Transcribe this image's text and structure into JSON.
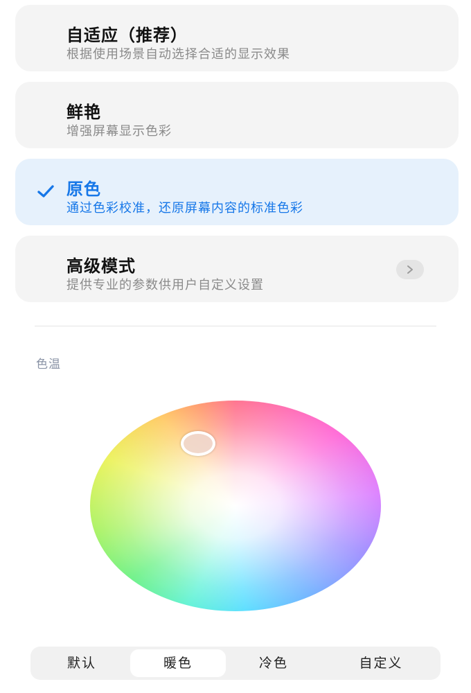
{
  "options": [
    {
      "title": "自适应（推荐）",
      "subtitle": "根据使用场景自动选择合适的显示效果",
      "selected": false
    },
    {
      "title": "鲜艳",
      "subtitle": "增强屏幕显示色彩",
      "selected": false
    },
    {
      "title": "原色",
      "subtitle": "通过色彩校准，还原屏幕内容的标准色彩",
      "selected": true
    },
    {
      "title": "高级模式",
      "subtitle": "提供专业的参数供用户自定义设置",
      "selected": false
    }
  ],
  "color_temperature": {
    "label": "色温",
    "presets": [
      "默认",
      "暖色",
      "冷色",
      "自定义"
    ],
    "active_preset": "暖色"
  },
  "colors": {
    "accent": "#1677e8",
    "selected_card_bg": "#e6f1fc",
    "card_bg": "#f4f4f4"
  },
  "icons": {
    "check": "check-icon",
    "chevron": "chevron-right-icon"
  }
}
